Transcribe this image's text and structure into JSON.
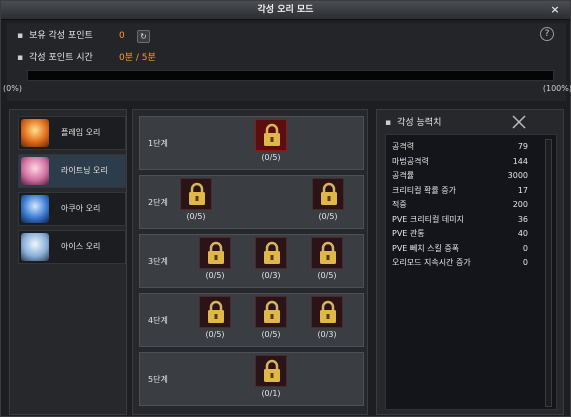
{
  "window": {
    "title": "각성 오리 모드"
  },
  "awaken": {
    "points_label": "보유 각성 포인트",
    "points_value": "0",
    "time_label": "각성 포인트 시간",
    "time_value": "0분 / 5분",
    "progress": 0,
    "progress_start": "(0%)",
    "progress_end": "(100%)"
  },
  "orbs": [
    {
      "label": "플레임 오리",
      "selected": false
    },
    {
      "label": "라이트닝 오리",
      "selected": true
    },
    {
      "label": "아쿠아 오리",
      "selected": false
    },
    {
      "label": "아이스 오리",
      "selected": false
    }
  ],
  "stages": [
    {
      "label": "1단계",
      "locks": [
        {
          "count": "(0/5)",
          "active": true
        }
      ]
    },
    {
      "label": "2단계",
      "locks": [
        {
          "count": "(0/5)"
        },
        {
          "count": "(0/5)"
        }
      ]
    },
    {
      "label": "3단계",
      "locks": [
        {
          "count": "(0/5)"
        },
        {
          "count": "(0/3)"
        },
        {
          "count": "(0/5)"
        }
      ]
    },
    {
      "label": "4단계",
      "locks": [
        {
          "count": "(0/5)"
        },
        {
          "count": "(0/5)"
        },
        {
          "count": "(0/3)"
        }
      ]
    },
    {
      "label": "5단계",
      "locks": [
        {
          "count": "(0/1)"
        }
      ]
    }
  ],
  "stats": {
    "title": "각성 능력치",
    "rows": [
      {
        "name": "공격력",
        "value": "79"
      },
      {
        "name": "마법공격력",
        "value": "144"
      },
      {
        "name": "공격률",
        "value": "3000"
      },
      {
        "name": "크리티컬 확률 증가",
        "value": "17"
      },
      {
        "name": "적중",
        "value": "200"
      },
      {
        "name": "PVE 크리티컬 데미지",
        "value": "36"
      },
      {
        "name": "PVE 관통",
        "value": "40"
      },
      {
        "name": "PVE 뻬치 스킬 증폭",
        "value": "0"
      },
      {
        "name": "오리모드 지속시간 증가",
        "value": "0"
      }
    ]
  },
  "colors": {
    "accent": "#ff9a2a",
    "selected": "#2d3c4a",
    "lock_active": "#5c0e0e"
  }
}
